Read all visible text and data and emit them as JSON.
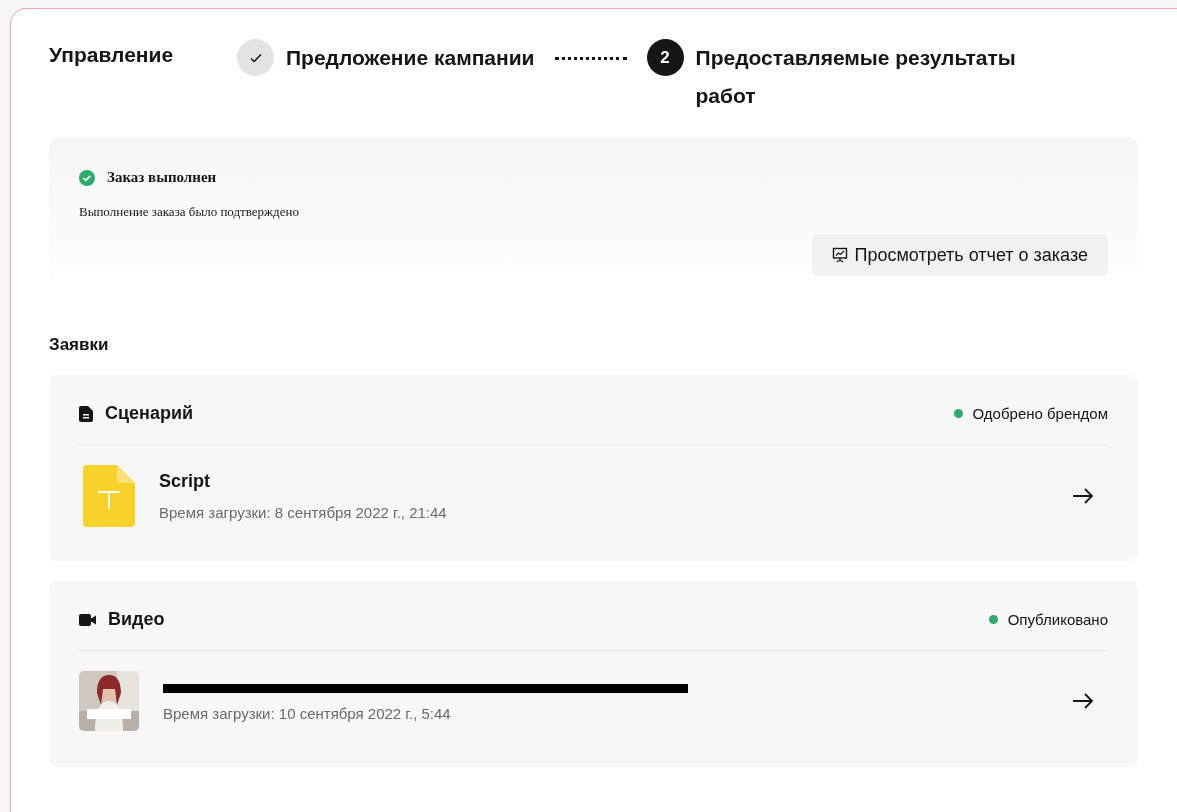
{
  "header": {
    "title": "Управление"
  },
  "steps": [
    {
      "label": "Предложение кампании",
      "completed": true
    },
    {
      "label": "Предоставляемые результаты работ",
      "number": "2",
      "completed": false
    }
  ],
  "order_status": {
    "title": "Заказ выполнен",
    "message": "Выполнение заказа было подтверждено",
    "button": "Просмотреть отчет о заказе"
  },
  "section_title": "Заявки",
  "submissions": [
    {
      "kind": "script",
      "title": "Сценарий",
      "status": "Одобрено брендом",
      "color": "#2eaa6a",
      "file": {
        "kind": "document",
        "name": "Script",
        "uploaded": "Время загрузки: 8 сентября 2022 г., 21:44"
      }
    },
    {
      "kind": "video",
      "title": "Видео",
      "status": "Опубликовано",
      "color": "#2eaa6a",
      "file": {
        "kind": "picture",
        "redacted": true,
        "uploaded": "Время загрузки: 10 сентября 2022 г., 5:44"
      }
    }
  ]
}
